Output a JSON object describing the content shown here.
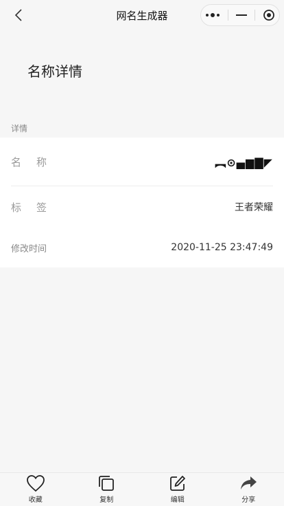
{
  "navbar": {
    "title": "网名生成器"
  },
  "page": {
    "heading": "名称详情",
    "section_label": "详情"
  },
  "details": {
    "name_label": "名称",
    "name_value": "︻⊙▄▆▇◤",
    "tag_label": "标签",
    "tag_value": "王者荣耀",
    "time_label": "修改时间",
    "time_value": "2020-11-25 23:47:49"
  },
  "tabbar": {
    "items": [
      {
        "label": "收藏",
        "icon": "heart-icon"
      },
      {
        "label": "复制",
        "icon": "copy-icon"
      },
      {
        "label": "编辑",
        "icon": "edit-icon"
      },
      {
        "label": "分享",
        "icon": "share-icon"
      }
    ]
  }
}
